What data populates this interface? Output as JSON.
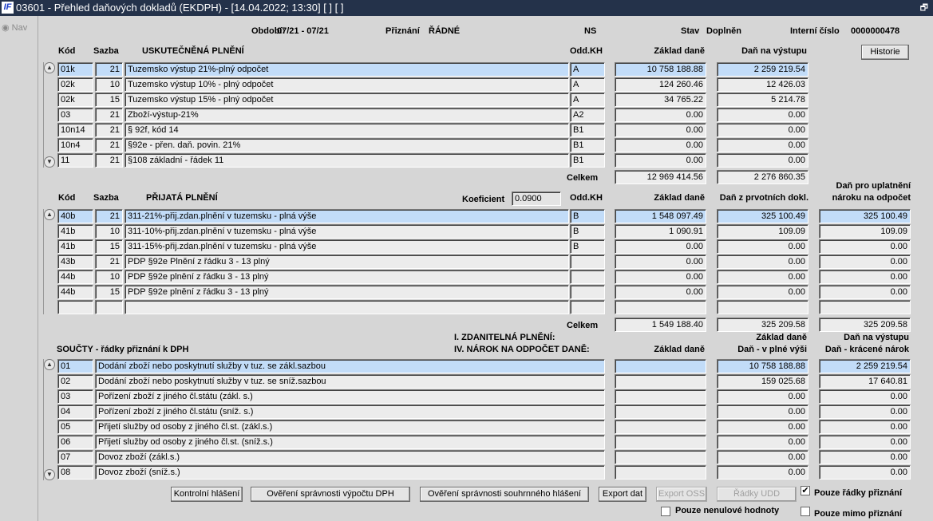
{
  "window": {
    "title": "03601 - Přehled daňových dokladů (EKDPH) - [14.04.2022; 13:30]  [ ]  [ ]",
    "logo": "IF",
    "restore_icon": "restore"
  },
  "nav": {
    "label": "Nav"
  },
  "header": {
    "obdobi_label": "Období:",
    "obdobi_value": "07/21 - 07/21",
    "priznani_label": "Přiznání",
    "priznani_value": "ŘÁDNÉ",
    "ns": "NS",
    "stav_label": "Stav",
    "stav_value": "Doplněn",
    "interni_label": "Interní číslo",
    "interni_value": "0000000478"
  },
  "section1": {
    "headers": {
      "kod": "Kód",
      "sazba": "Sazba",
      "nazev": "USKUTEČNĚNÁ PLNĚNÍ",
      "odd": "Odd.KH",
      "zaklad": "Základ daně",
      "dan": "Daň na výstupu"
    },
    "history_button": "Historie",
    "rows": [
      {
        "kod": "01k",
        "sazba": "21",
        "nazev": "Tuzemsko výstup 21%-plný odpočet",
        "odd": "A",
        "zaklad": "10 758 188.88",
        "dan": "2 259 219.54"
      },
      {
        "kod": "02k",
        "sazba": "10",
        "nazev": "Tuzemsko výstup 10% - plný odpočet",
        "odd": "A",
        "zaklad": "124 260.46",
        "dan": "12 426.03"
      },
      {
        "kod": "02k",
        "sazba": "15",
        "nazev": "Tuzemsko výstup 15% - plný odpočet",
        "odd": "A",
        "zaklad": "34 765.22",
        "dan": "5 214.78"
      },
      {
        "kod": "03",
        "sazba": "21",
        "nazev": "Zboží-výstup-21%",
        "odd": "A2",
        "zaklad": "0.00",
        "dan": "0.00"
      },
      {
        "kod": "10n14",
        "sazba": "21",
        "nazev": "§ 92f, kód 14",
        "odd": "B1",
        "zaklad": "0.00",
        "dan": "0.00"
      },
      {
        "kod": "10n4",
        "sazba": "21",
        "nazev": "§92e - přen. daň. povin. 21%",
        "odd": "B1",
        "zaklad": "0.00",
        "dan": "0.00"
      },
      {
        "kod": "11",
        "sazba": "21",
        "nazev": "§108 základní - řádek 11",
        "odd": "B1",
        "zaklad": "0.00",
        "dan": "0.00"
      }
    ],
    "total_label": "Celkem",
    "total_zaklad": "12 969 414.56",
    "total_dan": "2 276 860.35"
  },
  "section2": {
    "headers": {
      "kod": "Kód",
      "sazba": "Sazba",
      "nazev": "PŘIJATÁ PLNĚNÍ",
      "odd": "Odd.KH",
      "zaklad": "Základ daně",
      "dan": "Daň z prvotních dokl.",
      "narok1": "Daň pro uplatnění",
      "narok2": "nároku na odpočet"
    },
    "koeficient_label": "Koeficient",
    "koeficient_value": "0.0900",
    "rows": [
      {
        "kod": "40b",
        "sazba": "21",
        "nazev": "311-21%-přij.zdan.plnění v tuzemsku - plná výše",
        "odd": "B",
        "zaklad": "1 548 097.49",
        "dan": "325 100.49",
        "narok": "325 100.49"
      },
      {
        "kod": "41b",
        "sazba": "10",
        "nazev": "311-10%-přij.zdan.plnění v tuzemsku - plná výše",
        "odd": "B",
        "zaklad": "1 090.91",
        "dan": "109.09",
        "narok": "109.09"
      },
      {
        "kod": "41b",
        "sazba": "15",
        "nazev": "311-15%-přij.zdan.plnění v tuzemsku - plná výše",
        "odd": "B",
        "zaklad": "0.00",
        "dan": "0.00",
        "narok": "0.00"
      },
      {
        "kod": "43b",
        "sazba": "21",
        "nazev": "PDP §92e Plnění z řádku 3 - 13 plný",
        "odd": "",
        "zaklad": "0.00",
        "dan": "0.00",
        "narok": "0.00"
      },
      {
        "kod": "44b",
        "sazba": "10",
        "nazev": "PDP §92e plnění z řádku 3 - 13 plný",
        "odd": "",
        "zaklad": "0.00",
        "dan": "0.00",
        "narok": "0.00"
      },
      {
        "kod": "44b",
        "sazba": "15",
        "nazev": "PDP §92e plnění z řádku 3 - 13 plný",
        "odd": "",
        "zaklad": "0.00",
        "dan": "0.00",
        "narok": "0.00"
      },
      {
        "kod": "",
        "sazba": "",
        "nazev": "",
        "odd": "",
        "zaklad": "",
        "dan": "",
        "narok": ""
      }
    ],
    "total_label": "Celkem",
    "total_zaklad": "1 549 188.40",
    "total_dan": "325 209.58",
    "total_narok": "325 209.58"
  },
  "section3": {
    "title": "SOUČTY - řádky přiznání k DPH",
    "label1": "I. ZDANITELNÁ PLNĚNÍ:",
    "label2": "IV. NÁROK NA ODPOČET DANĚ:",
    "headers": {
      "zaklad": "Základ daně",
      "col2a": "Základ daně",
      "col2b": "Daň - v plné výši",
      "col3a": "Daň na výstupu",
      "col3b": "Daň - krácené nárok"
    },
    "rows": [
      {
        "kod": "01",
        "nazev": "Dodání zboží nebo poskytnutí služby v tuz. se zákl.sazbou",
        "zaklad": "",
        "plna": "10 758 188.88",
        "kracena": "2 259 219.54"
      },
      {
        "kod": "02",
        "nazev": "Dodání zboží nebo poskytnutí služby v tuz. se sníž.sazbou",
        "zaklad": "",
        "plna": "159 025.68",
        "kracena": "17 640.81"
      },
      {
        "kod": "03",
        "nazev": "Pořízení zboží z jiného čl.státu (zákl. s.)",
        "zaklad": "",
        "plna": "0.00",
        "kracena": "0.00"
      },
      {
        "kod": "04",
        "nazev": "Pořízení zboží z jiného čl.státu (sníž. s.)",
        "zaklad": "",
        "plna": "0.00",
        "kracena": "0.00"
      },
      {
        "kod": "05",
        "nazev": "Přijetí služby od osoby z jiného čl.st. (zákl.s.)",
        "zaklad": "",
        "plna": "0.00",
        "kracena": "0.00"
      },
      {
        "kod": "06",
        "nazev": "Přijetí služby od osoby z jiného čl.st. (sníž.s.)",
        "zaklad": "",
        "plna": "0.00",
        "kracena": "0.00"
      },
      {
        "kod": "07",
        "nazev": "Dovoz zboží (zákl.s.)",
        "zaklad": "",
        "plna": "0.00",
        "kracena": "0.00"
      },
      {
        "kod": "08",
        "nazev": "Dovoz zboží (sníž.s.)",
        "zaklad": "",
        "plna": "0.00",
        "kracena": "0.00"
      }
    ]
  },
  "footer": {
    "buttons": [
      "Kontrolní hlášení",
      "Ověření správnosti výpočtu DPH",
      "Ověření správnosti souhrnného hlášení",
      "Export dat",
      "Export OSS",
      "Řádky UDD"
    ],
    "checkboxes": [
      {
        "label": "Pouze řádky přiznání",
        "checked": true
      },
      {
        "label": "Pouze nenulové hodnoty",
        "checked": false
      },
      {
        "label": "Pouze mimo přiznání",
        "checked": false
      }
    ]
  },
  "colors": {
    "titlebar": "#24324a",
    "selected": "#c2dcf8",
    "background": "#d6d6d6"
  }
}
